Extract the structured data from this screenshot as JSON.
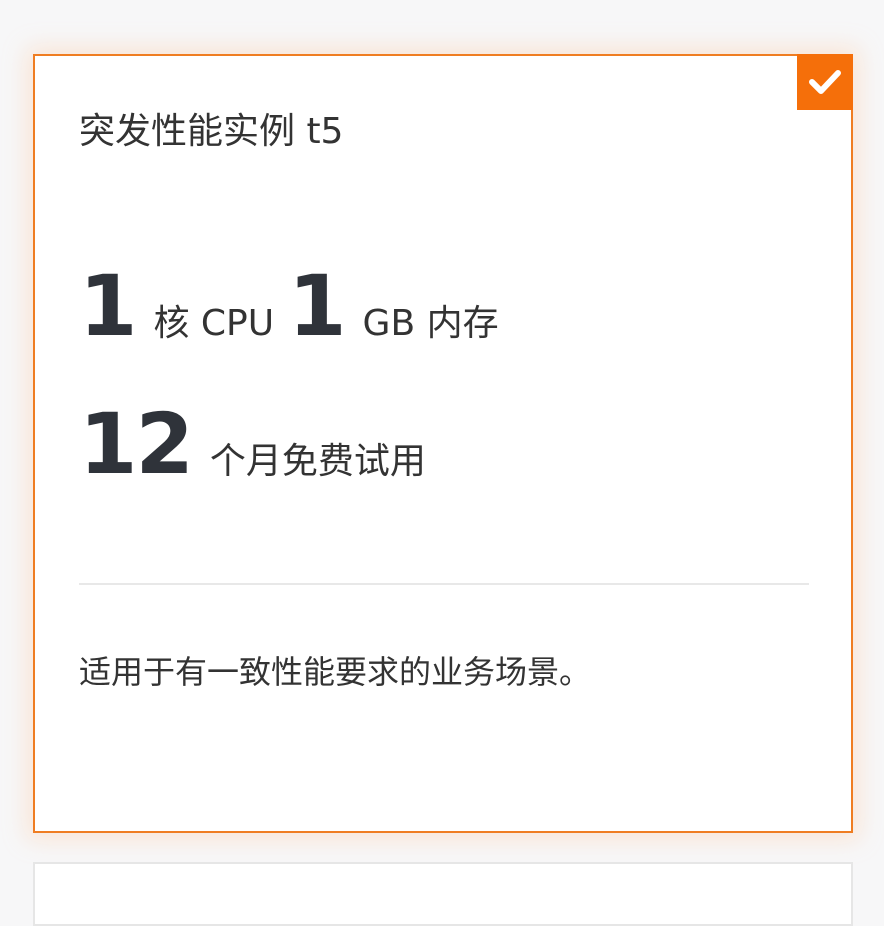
{
  "card": {
    "title": "突发性能实例 t5",
    "selected": true,
    "cpu_value": "1",
    "cpu_unit": "核 CPU",
    "memory_value": "1",
    "memory_unit": "GB 内存",
    "trial_value": "12",
    "trial_unit": "个月免费试用",
    "description": "适用于有一致性能要求的业务场景。"
  },
  "colors": {
    "accent": "#ef7d22",
    "badge": "#f56f0a",
    "text": "#333333"
  },
  "icons": {
    "badge": "checkmark-icon"
  }
}
